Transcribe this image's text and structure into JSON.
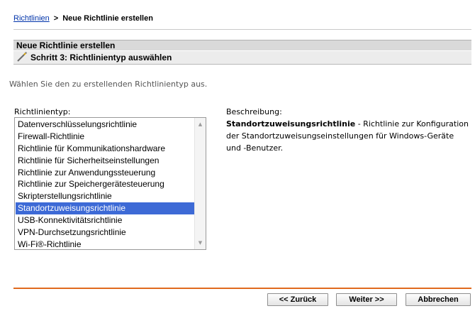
{
  "breadcrumb": {
    "link": "Richtlinien",
    "separator": ">",
    "current": "Neue Richtlinie erstellen"
  },
  "panel": {
    "title": "Neue Richtlinie erstellen",
    "step": "Schritt 3: Richtlinientyp auswählen"
  },
  "intro": "Wählen Sie den zu erstellenden Richtlinientyp aus.",
  "policy_list": {
    "label": "Richtlinientyp:",
    "items": [
      "Datenverschlüsselungsrichtlinie",
      "Firewall-Richtlinie",
      "Richtlinie für Kommunikationshardware",
      "Richtlinie für Sicherheitseinstellungen",
      "Richtlinie zur Anwendungssteuerung",
      "Richtlinie zur Speichergerätesteuerung",
      "Skripterstellungsrichtlinie",
      "Standortzuweisungsrichtlinie",
      "USB-Konnektivitätsrichtlinie",
      "VPN-Durchsetzungsrichtlinie",
      "Wi-Fi®-Richtlinie"
    ],
    "selected": "Standortzuweisungsrichtlinie"
  },
  "description": {
    "label": "Beschreibung:",
    "name": "Standortzuweisungsrichtlinie",
    "text": " - Richtlinie zur Konfiguration der Standortzuweisungseinstellungen für Windows-Geräte und -Benutzer."
  },
  "buttons": {
    "back": "<< Zurück",
    "next": "Weiter >>",
    "cancel": "Abbrechen"
  },
  "colors": {
    "selection": "#3d6ad6",
    "accent_line": "#e06a1e",
    "link": "#0033aa"
  },
  "icons": {
    "step": "wand-icon"
  }
}
